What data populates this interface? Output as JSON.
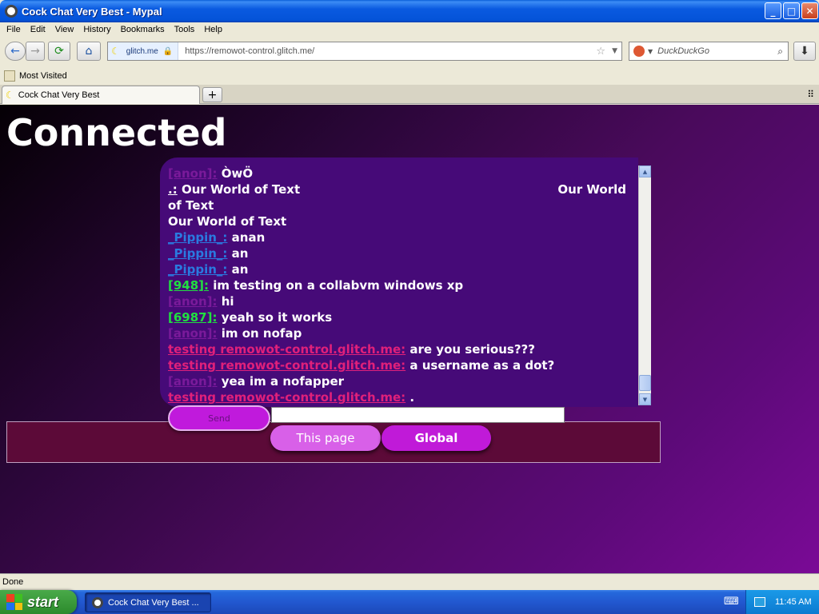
{
  "window": {
    "title": "Cock Chat Very Best - Mypal",
    "min": "_",
    "max": "□",
    "close": "✕"
  },
  "menu": [
    "File",
    "Edit",
    "View",
    "History",
    "Bookmarks",
    "Tools",
    "Help"
  ],
  "nav": {
    "back_icon": "←",
    "forward_icon": "→",
    "reload_icon": "⟳",
    "home_icon": "⌂",
    "site_label": "glitch.me",
    "url": "https://remowot-control.glitch.me/",
    "search_placeholder": "DuckDuckGo",
    "download_icon": "⬇"
  },
  "bookmarks": {
    "most_visited": "Most Visited"
  },
  "tab": {
    "label": "Cock Chat Very Best",
    "new_tab": "+"
  },
  "page": {
    "heading": "Connected",
    "messages": [
      {
        "name": "[anon]:",
        "text": "ÒwÖ"
      },
      {
        "name": ".:",
        "text": "Our World of Text",
        "text2": "Our World",
        "line2": "of Text",
        "line3": "Our World of Text"
      },
      {
        "name": "_Pippin_:",
        "text": "anan"
      },
      {
        "name": "_Pippin_:",
        "text": "an"
      },
      {
        "name": "_Pippin_:",
        "text": "an"
      },
      {
        "name": "[948]:",
        "text": "im testing on a collabvm windows xp"
      },
      {
        "name": "[anon]:",
        "text": "hi"
      },
      {
        "name": "[6987]:",
        "text": "yeah so it works"
      },
      {
        "name": "[anon]:",
        "text": "im on nofap"
      },
      {
        "name": "testing remowot-control.glitch.me:",
        "text": "are you serious???"
      },
      {
        "name": "testing remowot-control.glitch.me:",
        "text": "a username as a dot?"
      },
      {
        "name": "[anon]:",
        "text": "yea im a nofapper"
      },
      {
        "name": "testing remowot-control.glitch.me:",
        "text": "."
      }
    ],
    "send_label": "Send",
    "message_input_value": "",
    "scope_this_page": "This page",
    "scope_global": "Global"
  },
  "status": {
    "text": "Done"
  },
  "taskbar": {
    "start": "start",
    "task_label": "Cock Chat Very Best ...",
    "clock": "11:45 AM"
  },
  "colors": {
    "accent": "#c01ad8",
    "chat_bg": "#460a78",
    "name_blue": "#2a7ae0",
    "name_green": "#20e040",
    "name_pink": "#e0207a"
  }
}
